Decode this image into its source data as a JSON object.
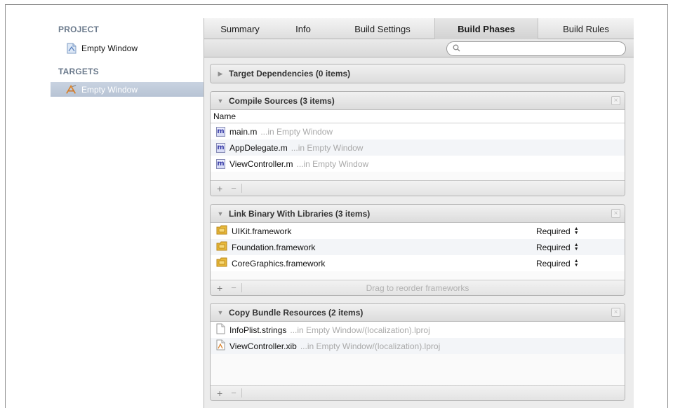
{
  "sidebar": {
    "project_heading": "PROJECT",
    "project_item": "Empty Window",
    "targets_heading": "TARGETS",
    "target_item": "Empty Window"
  },
  "tabs": [
    {
      "label": "Summary"
    },
    {
      "label": "Info"
    },
    {
      "label": "Build Settings"
    },
    {
      "label": "Build Phases",
      "active": true
    },
    {
      "label": "Build Rules"
    }
  ],
  "search": {
    "value": "",
    "placeholder": ""
  },
  "phases": {
    "target_dependencies": {
      "title": "Target Dependencies (0 items)"
    },
    "compile_sources": {
      "title": "Compile Sources (3 items)",
      "column_header": "Name",
      "files": [
        {
          "name": "main.m",
          "path": "...in Empty Window"
        },
        {
          "name": "AppDelegate.m",
          "path": "...in Empty Window"
        },
        {
          "name": "ViewController.m",
          "path": "...in Empty Window"
        }
      ]
    },
    "link_binary": {
      "title": "Link Binary With Libraries (3 items)",
      "libraries": [
        {
          "name": "UIKit.framework",
          "status": "Required"
        },
        {
          "name": "Foundation.framework",
          "status": "Required"
        },
        {
          "name": "CoreGraphics.framework",
          "status": "Required"
        }
      ],
      "footer_hint": "Drag to reorder frameworks"
    },
    "copy_bundle": {
      "title": "Copy Bundle Resources (2 items)",
      "files": [
        {
          "name": "InfoPlist.strings",
          "path": "...in Empty Window/(localization).lproj"
        },
        {
          "name": "ViewController.xib",
          "path": "...in Empty Window/(localization).lproj"
        }
      ]
    }
  },
  "icons": {
    "disclosure_collapsed": "triangle-right-icon",
    "disclosure_expanded": "triangle-down-icon",
    "plus": "+",
    "minus": "−",
    "close": "×",
    "m_file": "m",
    "stepper": "▲▼"
  },
  "colors": {
    "selection": "#c3cddb",
    "sidebar_heading": "#6b7a8c",
    "path_text": "#a9a9a9"
  }
}
